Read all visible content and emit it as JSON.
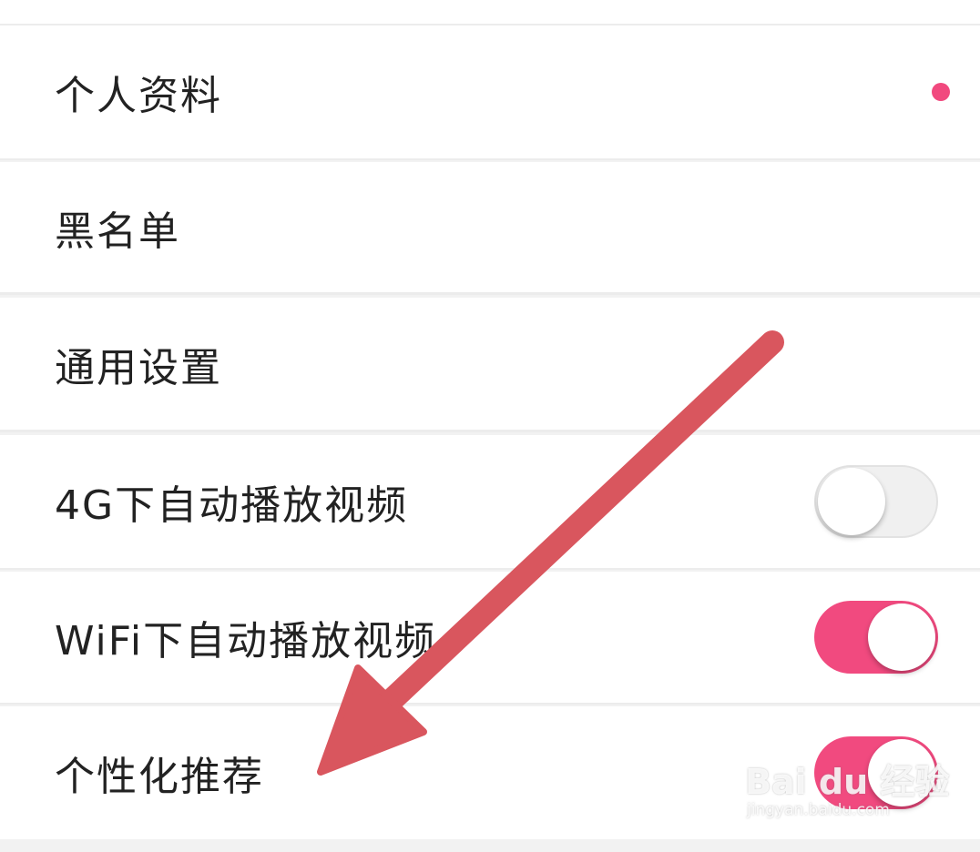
{
  "colors": {
    "accent": "#f14a7f",
    "arrow": "#d9565e",
    "divider": "#ececec",
    "text": "#222222"
  },
  "settings": {
    "items": [
      {
        "label": "个人资料",
        "control": "dot"
      },
      {
        "label": "黑名单",
        "control": "none"
      },
      {
        "label": "通用设置",
        "control": "none"
      },
      {
        "label": "4G下自动播放视频",
        "control": "toggle",
        "on": false
      },
      {
        "label": "WiFi下自动播放视频",
        "control": "toggle",
        "on": true
      },
      {
        "label": "个性化推荐",
        "control": "toggle",
        "on": true
      }
    ]
  },
  "watermark": {
    "brand": "Bai du 经验",
    "url": "jingyan.baidu.com"
  }
}
